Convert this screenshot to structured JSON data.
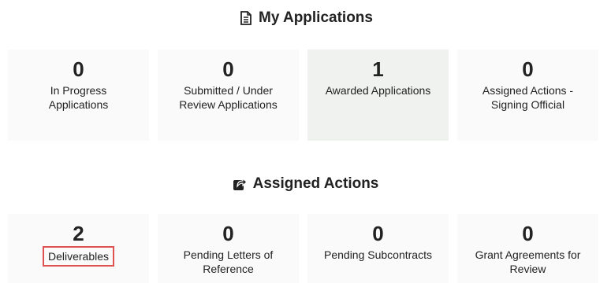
{
  "my_applications": {
    "title": "My Applications",
    "icon": "document-icon",
    "cards": [
      {
        "count": "0",
        "label": "In Progress Applications"
      },
      {
        "count": "0",
        "label": "Submitted / Under Review Applications"
      },
      {
        "count": "1",
        "label": "Awarded Applications"
      },
      {
        "count": "0",
        "label": "Assigned Actions - Signing Official"
      }
    ]
  },
  "assigned_actions": {
    "title": "Assigned Actions",
    "icon": "share-icon",
    "cards": [
      {
        "count": "2",
        "label": "Deliverables"
      },
      {
        "count": "0",
        "label": "Pending Letters of Reference"
      },
      {
        "count": "0",
        "label": "Pending Subcontracts"
      },
      {
        "count": "0",
        "label": "Grant Agreements for Review"
      }
    ]
  },
  "colors": {
    "highlight_outline": "#e05252",
    "card_background": "#fafafa",
    "hover_card_background": "#f0f2f0"
  }
}
